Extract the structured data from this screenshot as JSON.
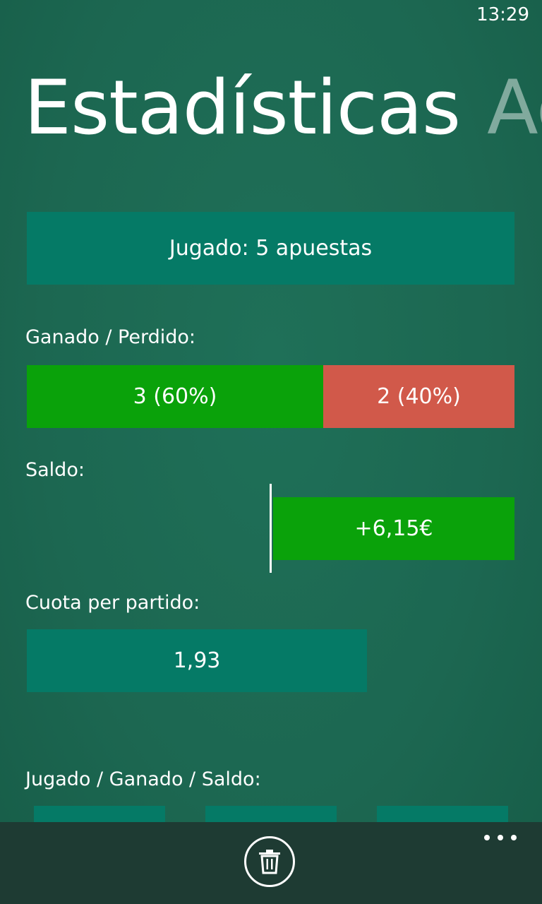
{
  "status": {
    "time": "13:29"
  },
  "pivot": {
    "active": "Estadísticas",
    "next": "Act"
  },
  "played": {
    "text": "Jugado: 5 apuestas"
  },
  "won_lost": {
    "label": "Ganado / Perdido:",
    "won": "3 (60%)",
    "lost": "2 (40%)",
    "won_fraction": 0.6,
    "lost_fraction": 0.4
  },
  "balance": {
    "label": "Saldo:",
    "value": "+6,15€"
  },
  "odds": {
    "label": "Cuota per partido:",
    "value": "1,93"
  },
  "summary": {
    "label": "Jugado / Ganado / Saldo:"
  },
  "appbar": {
    "delete_icon": "trash-icon",
    "more_icon": "more-icon"
  },
  "colors": {
    "background": "#1d6b54",
    "teal": "#057a66",
    "won": "#0aa20a",
    "lost": "#d1594a",
    "appbar": "#1e3b33"
  }
}
